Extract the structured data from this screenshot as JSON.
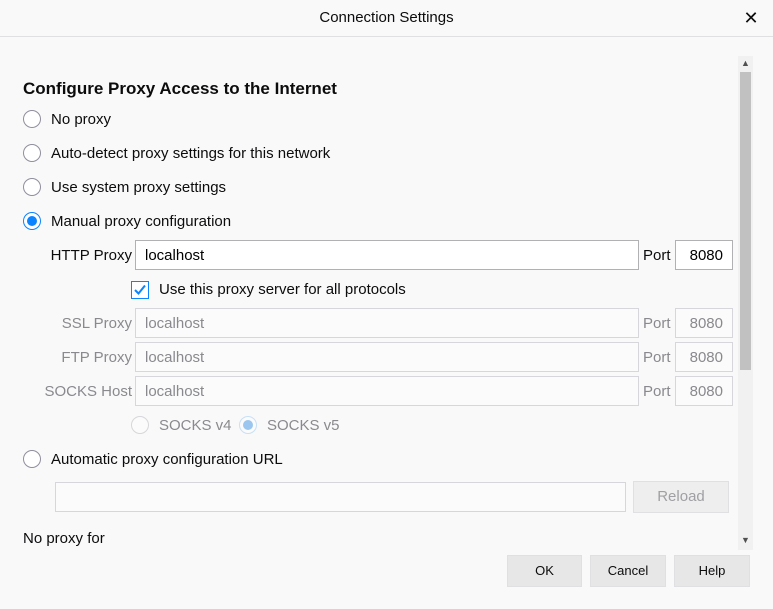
{
  "window": {
    "title": "Connection Settings"
  },
  "heading": "Configure Proxy Access to the Internet",
  "radios": {
    "no_proxy": "No proxy",
    "auto_detect": "Auto-detect proxy settings for this network",
    "system": "Use system proxy settings",
    "manual": "Manual proxy configuration",
    "auto_url": "Automatic proxy configuration URL",
    "selected": "manual"
  },
  "http": {
    "label": "HTTP Proxy",
    "value": "localhost",
    "port_label": "Port",
    "port": "8080"
  },
  "use_all": {
    "label": "Use this proxy server for all protocols",
    "checked": true
  },
  "ssl": {
    "label": "SSL Proxy",
    "value": "localhost",
    "port_label": "Port",
    "port": "8080"
  },
  "ftp": {
    "label": "FTP Proxy",
    "value": "localhost",
    "port_label": "Port",
    "port": "8080"
  },
  "socks": {
    "label": "SOCKS Host",
    "value": "localhost",
    "port_label": "Port",
    "port": "8080",
    "v4": "SOCKS v4",
    "v5": "SOCKS v5",
    "selected": "v5"
  },
  "auto_url": {
    "value": "",
    "reload_label": "Reload"
  },
  "no_proxy_for": "No proxy for",
  "buttons": {
    "ok": "OK",
    "cancel": "Cancel",
    "help": "Help"
  },
  "colors": {
    "accent": "#0a84ff",
    "background": "#f9f9fa"
  }
}
